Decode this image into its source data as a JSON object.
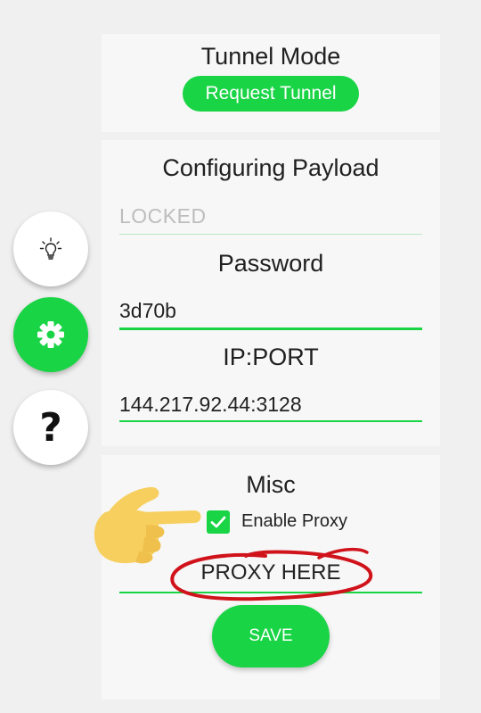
{
  "tunnel": {
    "title": "Tunnel Mode",
    "mode_button": "Request Tunnel"
  },
  "payload": {
    "title": "Configuring Payload",
    "payload_value": "LOCKED",
    "password_label": "Password",
    "password_value": "3d70b",
    "ipport_label": "IP:PORT",
    "ipport_value": "144.217.92.44:3128"
  },
  "misc": {
    "title": "Misc",
    "enable_proxy_label": "Enable Proxy",
    "enable_proxy_checked": true,
    "proxy_value": "PROXY HERE",
    "save_label": "SAVE"
  },
  "side_buttons": [
    {
      "icon": "lightbulb-icon"
    },
    {
      "icon": "gear-icon"
    },
    {
      "icon": "help-icon",
      "glyph": "?"
    }
  ],
  "colors": {
    "accent": "#19d445",
    "annotation_red": "#d0131b",
    "hand_yellow": "#f7cf5f"
  }
}
